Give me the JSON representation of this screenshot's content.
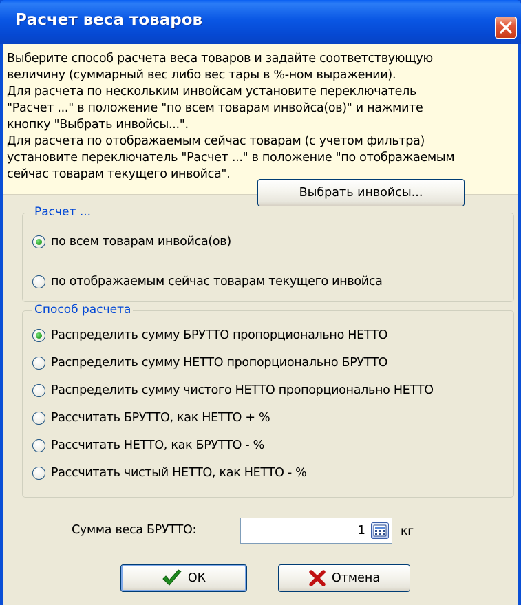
{
  "window": {
    "title": "Расчет веса товаров",
    "close_icon": "close-icon"
  },
  "info": {
    "lines": [
      "Выберите способ расчета веса товаров и задайте соответствующую",
      "величину (суммарный вес либо вес тары в %-ном выражении).",
      "Для расчета по нескольким инвойсам установите переключатель",
      "\"Расчет ...\" в положение \"по всем товарам инвойса(ов)\" и  нажмите",
      "кнопку \"Выбрать инвойсы...\".",
      "Для расчета по отображаемым сейчас товарам (с учетом фильтра)",
      "установите переключатель \"Расчет ...\" в положение \"по отображаемым",
      "сейчас товарам текущего инвойса\"."
    ]
  },
  "calc_scope": {
    "caption": "Расчет ...",
    "options": [
      {
        "label": "по всем товарам инвойса(ов)",
        "checked": true
      },
      {
        "label": "по отображаемым сейчас товарам текущего инвойса",
        "checked": false
      }
    ],
    "select_invoices_label": "Выбрать инвойсы..."
  },
  "calc_method": {
    "caption": "Способ расчета",
    "options": [
      {
        "label": "Распределить сумму БРУТТО пропорционально НЕТТО",
        "checked": true
      },
      {
        "label": "Распределить сумму НЕТТО пропорционально БРУТТО",
        "checked": false
      },
      {
        "label": "Распределить сумму чистого НЕТТО пропорционально НЕТТО",
        "checked": false
      },
      {
        "label": "Рассчитать БРУТТО, как НЕТТО + %",
        "checked": false
      },
      {
        "label": "Рассчитать НЕТТО, как БРУТТО - %",
        "checked": false
      },
      {
        "label": "Рассчитать чистый НЕТТО, как НЕТТО - %",
        "checked": false
      }
    ]
  },
  "gross_weight": {
    "label": "Сумма веса БРУТТО:",
    "value": "1",
    "unit": "кг"
  },
  "buttons": {
    "ok_label": "ОК",
    "cancel_label": "Отмена"
  },
  "colors": {
    "title_bar": "#0a57e4",
    "info_background": "#fffbe0",
    "group_caption": "#0046d5",
    "dialog_background": "#ece9d8"
  }
}
